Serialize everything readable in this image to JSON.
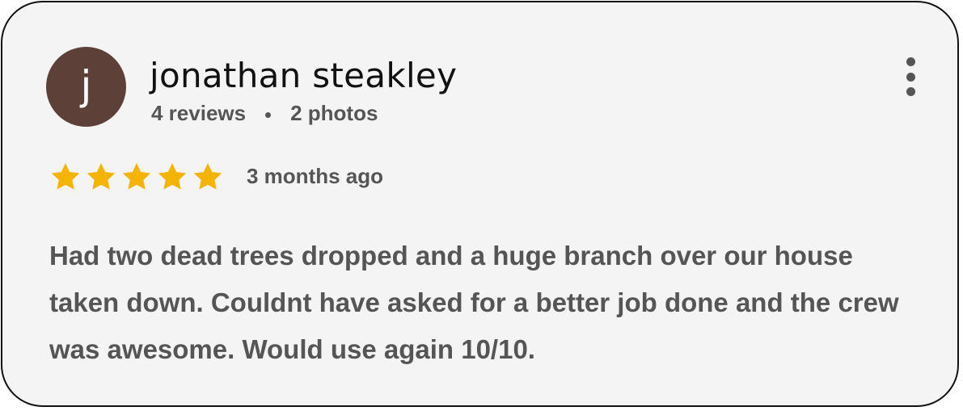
{
  "review": {
    "avatar_letter": "j",
    "avatar_color": "#5d4037",
    "author_name": "jonathan steakley",
    "reviews_count": "4 reviews",
    "photos_count": "2 photos",
    "rating": 5,
    "rating_max": 5,
    "star_color": "#f4b400",
    "time_ago": "3 months ago",
    "text": "Had two dead trees dropped and a huge branch over our house taken down. Couldnt have asked for a better job done and the crew was awesome. Would use again 10/10.",
    "menu_icon": "more-vert-icon"
  }
}
